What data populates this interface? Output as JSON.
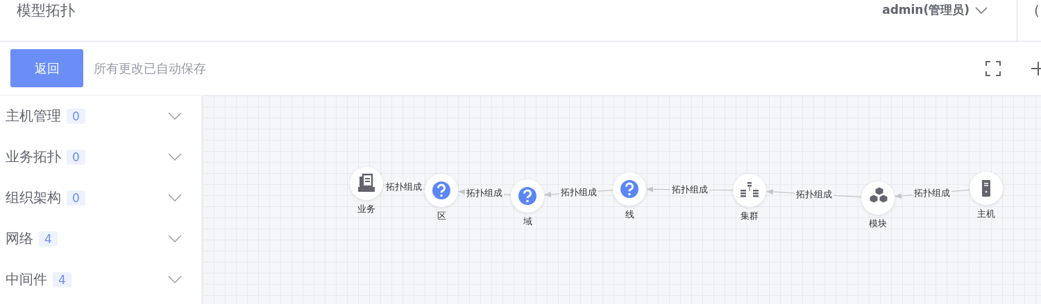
{
  "header": {
    "title": "模型拓扑",
    "user": "admin(管理员)",
    "cut_text": "("
  },
  "toolbar": {
    "back_button": "返回",
    "status": "所有更改已自动保存"
  },
  "sidebar": {
    "groups": [
      {
        "label": "主机管理",
        "count": "0",
        "expanded": false
      },
      {
        "label": "业务拓扑",
        "count": "0",
        "expanded": false
      },
      {
        "label": "组织架构",
        "count": "0",
        "expanded": false
      },
      {
        "label": "网络",
        "count": "4",
        "expanded": false
      },
      {
        "label": "中间件",
        "count": "4",
        "expanded": false
      }
    ]
  },
  "diagram": {
    "nodes": [
      {
        "label": "业务",
        "kind": "business"
      },
      {
        "label": "区",
        "kind": "unknown"
      },
      {
        "label": "域",
        "kind": "unknown"
      },
      {
        "label": "线",
        "kind": "unknown"
      },
      {
        "label": "集群",
        "kind": "cluster"
      },
      {
        "label": "模块",
        "kind": "module"
      },
      {
        "label": "主机",
        "kind": "host"
      }
    ],
    "edges": [
      {
        "label": "拓扑组成"
      },
      {
        "label": "拓扑组成"
      },
      {
        "label": "拓扑组成"
      },
      {
        "label": "拓扑组成"
      },
      {
        "label": "拓扑组成"
      },
      {
        "label": "拓扑组成"
      }
    ]
  }
}
